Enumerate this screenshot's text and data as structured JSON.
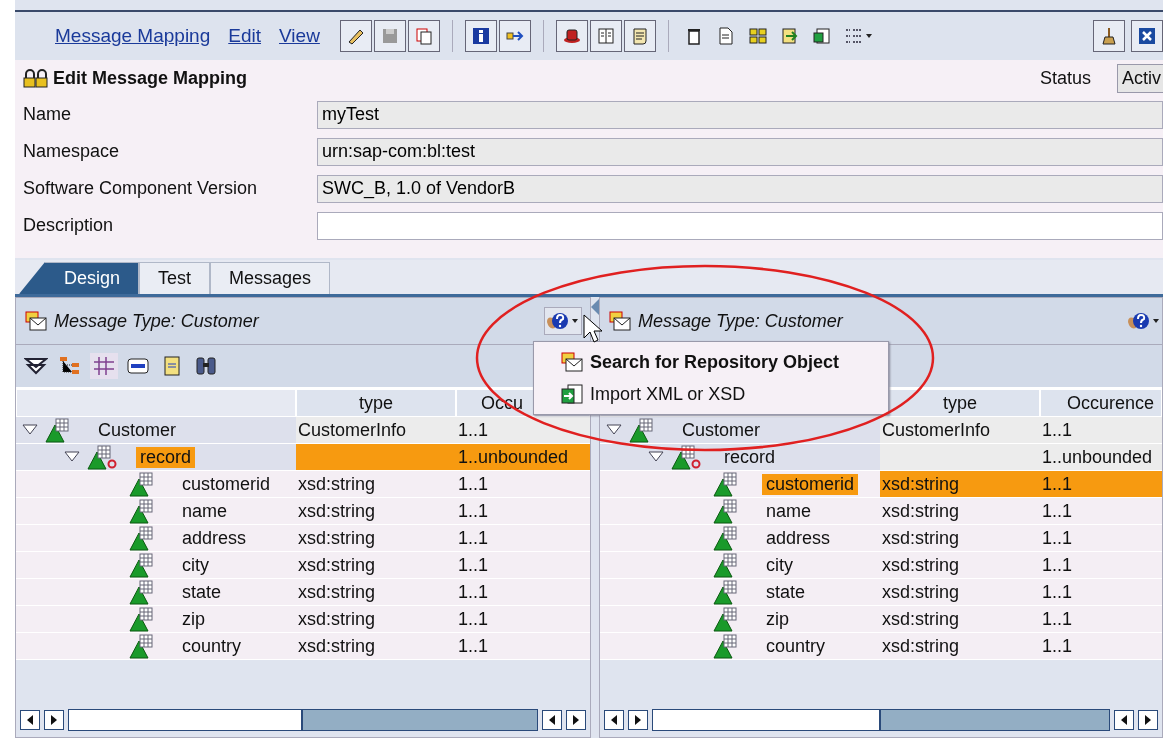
{
  "menu": [
    {
      "label": "Message Mapping"
    },
    {
      "label": "Edit"
    },
    {
      "label": "View"
    }
  ],
  "editor": {
    "title": "Edit Message Mapping",
    "status_label": "Status",
    "status_value": "Activ"
  },
  "fields": [
    {
      "label": "Name",
      "value": "myTest"
    },
    {
      "label": "Namespace",
      "value": "urn:sap-com:bl:test"
    },
    {
      "label": "Software Component Version",
      "value": "SWC_B, 1.0 of VendorB"
    },
    {
      "label": "Description"
    }
  ],
  "tabs": [
    {
      "label": "Design",
      "selected": true
    },
    {
      "label": "Test",
      "selected": false
    },
    {
      "label": "Messages",
      "selected": false
    }
  ],
  "panes": [
    {
      "title": "Message Type: Customer",
      "columns": [
        "type",
        "Occu"
      ],
      "tree": [
        {
          "name": "Customer",
          "type": "CustomerInfo",
          "occurrence": "1..1",
          "kind": "element",
          "expanded": true,
          "selected": false,
          "children": [
            {
              "name": "record",
              "occurrence": "1..unbounded",
              "kind": "flagged",
              "expanded": true,
              "selected": true,
              "children": [
                {
                  "name": "customerid",
                  "type": "xsd:string",
                  "occurrence": "1..1",
                  "kind": "element",
                  "selected": false
                },
                {
                  "name": "name",
                  "type": "xsd:string",
                  "occurrence": "1..1",
                  "kind": "element",
                  "selected": false
                },
                {
                  "name": "address",
                  "type": "xsd:string",
                  "occurrence": "1..1",
                  "kind": "element",
                  "selected": false
                },
                {
                  "name": "city",
                  "type": "xsd:string",
                  "occurrence": "1..1",
                  "kind": "element",
                  "selected": false
                },
                {
                  "name": "state",
                  "type": "xsd:string",
                  "occurrence": "1..1",
                  "kind": "element",
                  "selected": false
                },
                {
                  "name": "zip",
                  "type": "xsd:string",
                  "occurrence": "1..1",
                  "kind": "element",
                  "selected": false
                },
                {
                  "name": "country",
                  "type": "xsd:string",
                  "occurrence": "1..1",
                  "kind": "element",
                  "selected": false
                }
              ]
            }
          ]
        }
      ]
    },
    {
      "title": "Message Type: Customer",
      "columns": [
        "type",
        "Occurence"
      ],
      "tree": [
        {
          "name": "Customer",
          "type": "CustomerInfo",
          "occurrence": "1..1",
          "kind": "element",
          "expanded": true,
          "selected": false,
          "children": [
            {
              "name": "record",
              "occurrence": "1..unbounded",
              "kind": "flagged",
              "expanded": true,
              "selected": false,
              "children": [
                {
                  "name": "customerid",
                  "type": "xsd:string",
                  "occurrence": "1..1",
                  "kind": "element",
                  "selected": true
                },
                {
                  "name": "name",
                  "type": "xsd:string",
                  "occurrence": "1..1",
                  "kind": "element",
                  "selected": false
                },
                {
                  "name": "address",
                  "type": "xsd:string",
                  "occurrence": "1..1",
                  "kind": "element",
                  "selected": false
                },
                {
                  "name": "city",
                  "type": "xsd:string",
                  "occurrence": "1..1",
                  "kind": "element",
                  "selected": false
                },
                {
                  "name": "state",
                  "type": "xsd:string",
                  "occurrence": "1..1",
                  "kind": "element",
                  "selected": false
                },
                {
                  "name": "zip",
                  "type": "xsd:string",
                  "occurrence": "1..1",
                  "kind": "element",
                  "selected": false
                },
                {
                  "name": "country",
                  "type": "xsd:string",
                  "occurrence": "1..1",
                  "kind": "element",
                  "selected": false
                }
              ]
            }
          ]
        }
      ]
    }
  ],
  "popup_menu": [
    {
      "label": "Search for Repository Object",
      "kind": "search"
    },
    {
      "label": "Import XML or XSD",
      "kind": "import"
    }
  ]
}
